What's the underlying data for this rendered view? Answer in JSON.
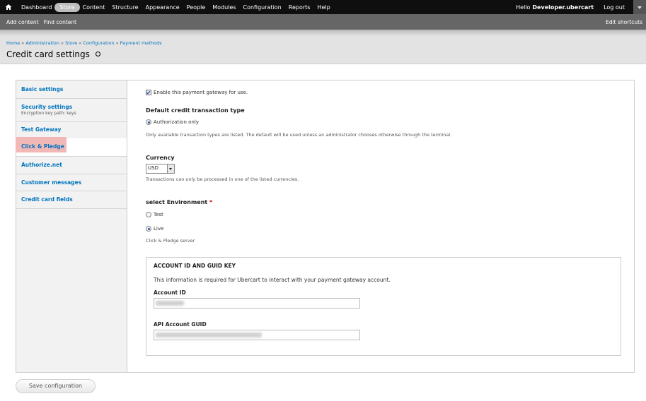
{
  "toolbar": {
    "items": [
      "Dashboard",
      "Store",
      "Content",
      "Structure",
      "Appearance",
      "People",
      "Modules",
      "Configuration",
      "Reports",
      "Help"
    ],
    "active": "Store",
    "greeting": "Hello",
    "username": "Developer.ubercart",
    "logout": "Log out"
  },
  "shortcuts": {
    "links": [
      "Add content",
      "Find content"
    ],
    "edit": "Edit shortcuts"
  },
  "breadcrumb": {
    "items": [
      "Home",
      "Administration",
      "Store",
      "Configuration",
      "Payment methods"
    ],
    "separator": "»"
  },
  "page_title": "Credit card settings",
  "tabs": [
    {
      "title": "Basic settings",
      "summary": ""
    },
    {
      "title": "Security settings",
      "summary": "Encryption key path: keys"
    },
    {
      "title": "Test Gateway",
      "summary": ""
    },
    {
      "title": "Click & Pledge",
      "summary": ""
    },
    {
      "title": "Authorize.net",
      "summary": ""
    },
    {
      "title": "Customer messages",
      "summary": ""
    },
    {
      "title": "Credit card fields",
      "summary": ""
    }
  ],
  "selected_tab": "Click & Pledge",
  "form": {
    "enable_label": "Enable this payment gateway for use.",
    "txn_type_label": "Default credit transaction type",
    "txn_type_option": "Authorization only",
    "txn_type_desc": "Only available transaction types are listed. The default will be used unless an administrator chooses otherwise through the terminal.",
    "currency_label": "Currency",
    "currency_value": "USD",
    "currency_desc": "Transactions can only be processed in one of the listed currencies.",
    "env_label": "select Environment",
    "env_required": "*",
    "env_test": "Test",
    "env_live": "Live",
    "env_desc": "Click & Pledge server",
    "fieldset_title": "ACCOUNT ID AND GUID KEY",
    "fieldset_desc": "This information is required for Ubercart to interact with your payment gateway account.",
    "account_id_label": "Account ID",
    "api_guid_label": "API Account GUID"
  },
  "save_button": "Save configuration",
  "colors": {
    "toolbar_bg": "#0f0f0f",
    "shortcut_bg": "#666666",
    "link": "#0074bd",
    "selected_tab_highlight": "#f2b8b8",
    "required": "#cc0000"
  }
}
